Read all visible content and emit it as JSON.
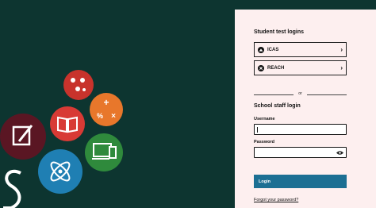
{
  "student": {
    "heading": "Student test logins",
    "options": [
      {
        "label": "ICAS",
        "icon": "icas-logo-icon"
      },
      {
        "label": "REACH",
        "icon": "reach-logo-icon"
      }
    ]
  },
  "divider_text": "or",
  "staff": {
    "heading": "School staff login",
    "username_label": "Username",
    "username_value": "",
    "password_label": "Password",
    "password_value": "",
    "login_button": "Login",
    "forgot_link": "Forgot your password?"
  },
  "colors": {
    "background": "#0d3530",
    "panel": "#fdefef",
    "login_button": "#1c6f93",
    "circle_red_dark": "#c8332c",
    "circle_red": "#d83a35",
    "circle_orange": "#e8772b",
    "circle_green": "#2f8a3c",
    "circle_blue": "#1f7fb3",
    "circle_maroon": "#5a1623"
  }
}
